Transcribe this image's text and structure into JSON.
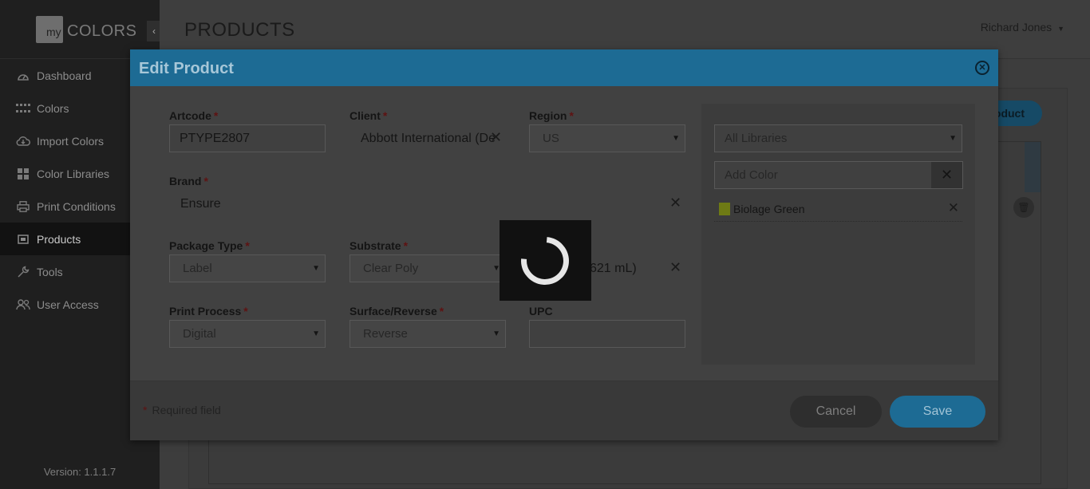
{
  "sidebar": {
    "logo_my": "my",
    "logo_colors": "COLORS",
    "collapse_icon": "‹",
    "items": [
      {
        "label": "Dashboard",
        "icon": "dashboard-icon"
      },
      {
        "label": "Colors",
        "icon": "colors-grid-icon"
      },
      {
        "label": "Import Colors",
        "icon": "cloud-import-icon"
      },
      {
        "label": "Color Libraries",
        "icon": "libraries-grid-icon"
      },
      {
        "label": "Print Conditions",
        "icon": "printer-icon"
      },
      {
        "label": "Products",
        "icon": "products-icon",
        "active": true
      },
      {
        "label": "Tools",
        "icon": "wrench-icon"
      },
      {
        "label": "User Access",
        "icon": "users-icon"
      }
    ],
    "version": "Version: 1.1.1.7"
  },
  "header": {
    "title": "PRODUCTS",
    "user": "Richard Jones"
  },
  "background": {
    "add_product_label": "oduct"
  },
  "modal": {
    "title": "Edit Product",
    "fields": {
      "artcode": {
        "label": "Artcode",
        "value": "PTYPE2807"
      },
      "client": {
        "label": "Client",
        "value": "Abbott International (De"
      },
      "region": {
        "label": "Region",
        "value": "US"
      },
      "brand": {
        "label": "Brand",
        "value": "Ensure"
      },
      "package_type": {
        "label": "Package Type",
        "value": "Label"
      },
      "substrate": {
        "label": "Substrate",
        "value": "Clear Poly"
      },
      "size": {
        "value": "621 mL)"
      },
      "print_process": {
        "label": "Print Process",
        "value": "Digital"
      },
      "surface_reverse": {
        "label": "Surface/Reverse",
        "value": "Reverse"
      },
      "upc": {
        "label": "UPC",
        "value": ""
      }
    },
    "required_star": "*",
    "clear_glyph": "✕",
    "library_select": "All Libraries",
    "add_color_placeholder": "Add Color",
    "colors": [
      {
        "name": "Biolage Green",
        "swatch": "#6e7a14"
      }
    ],
    "footer": {
      "required_note": "Required field",
      "cancel_label": "Cancel",
      "save_label": "Save"
    }
  },
  "colors": {
    "accent": "#1d6b94",
    "sidebar_bg": "#1f1f1f"
  }
}
